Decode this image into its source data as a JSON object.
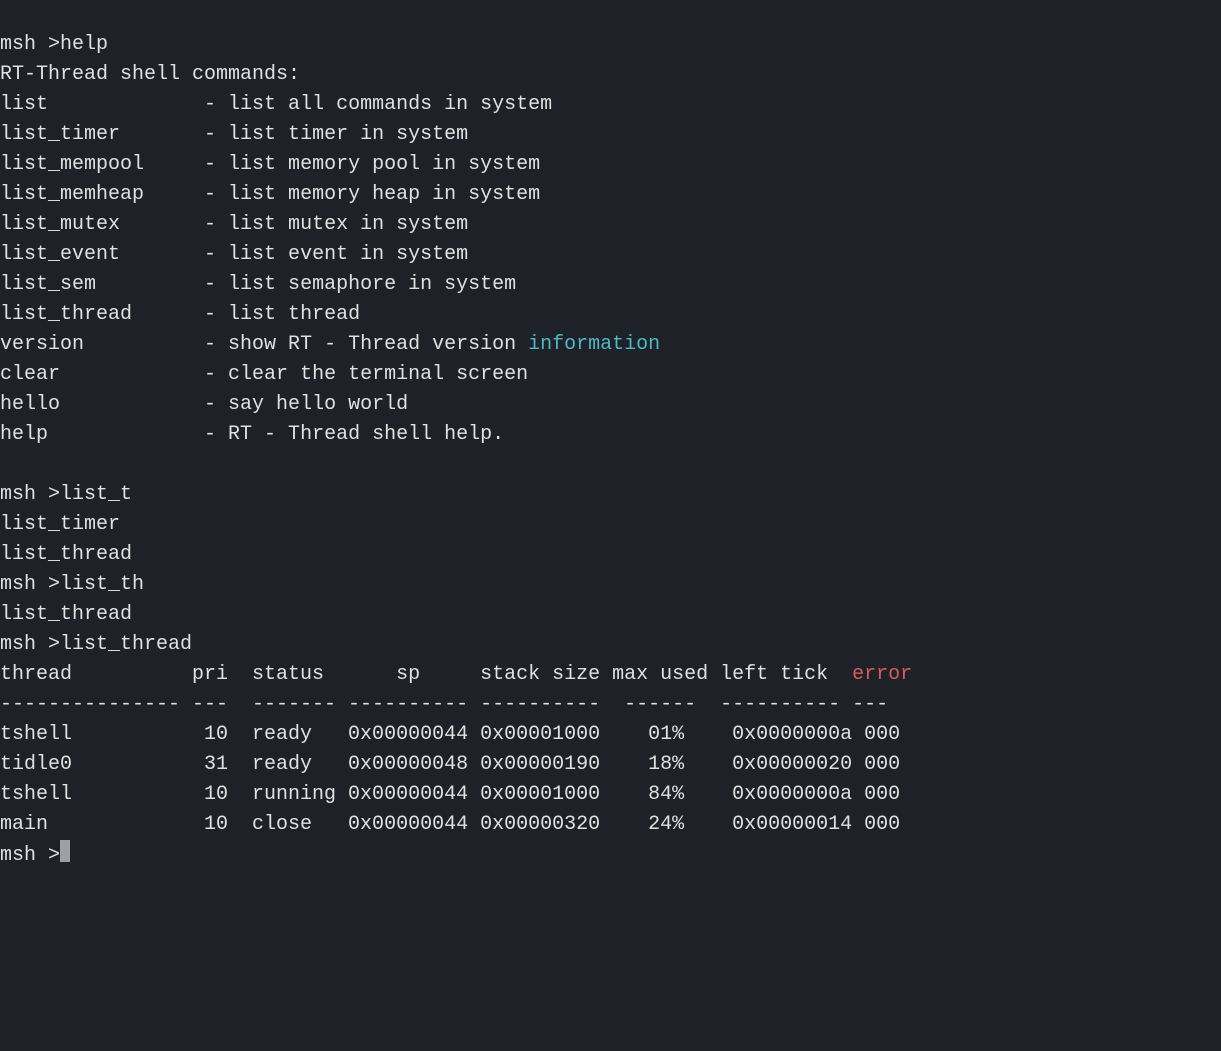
{
  "lines": {
    "0": {
      "prompt": "msh >",
      "cmd": "help"
    },
    "1": "RT-Thread shell commands:",
    "2": {
      "prompt": "msh >",
      "cmd": "list_t"
    },
    "3": "list_timer",
    "4": "list_thread",
    "5": {
      "prompt": "msh >",
      "cmd": "list_th"
    },
    "6": "list_thread",
    "7": {
      "prompt": "msh >",
      "cmd": "list_thread"
    },
    "8": {
      "prompt": "msh >"
    }
  },
  "help": [
    {
      "name": "list",
      "pad": "             ",
      "desc": "- list all commands in system"
    },
    {
      "name": "list_timer",
      "pad": "       ",
      "desc": "- list timer in system"
    },
    {
      "name": "list_mempool",
      "pad": "     ",
      "desc": "- list memory pool in system"
    },
    {
      "name": "list_memheap",
      "pad": "     ",
      "desc": "- list memory heap in system"
    },
    {
      "name": "list_mutex",
      "pad": "       ",
      "desc": "- list mutex in system"
    },
    {
      "name": "list_event",
      "pad": "       ",
      "desc": "- list event in system"
    },
    {
      "name": "list_sem",
      "pad": "         ",
      "desc": "- list semaphore in system"
    },
    {
      "name": "list_thread",
      "pad": "      ",
      "desc": "- list thread"
    },
    {
      "name": "version",
      "pad": "          ",
      "desc": "- show RT - Thread version ",
      "kw": "information"
    },
    {
      "name": "clear",
      "pad": "            ",
      "desc": "- clear the terminal screen"
    },
    {
      "name": "hello",
      "pad": "            ",
      "desc": "- say hello world"
    },
    {
      "name": "help",
      "pad": "             ",
      "desc": "- RT - Thread shell help."
    }
  ],
  "table": {
    "header": "thread          pri  status      sp     stack size max used left tick  ",
    "header_err": "error",
    "sep": "--------------- ---  ------- ---------- ----------  ------  ---------- ---",
    "rows": [
      "tshell           10  ready   0x00000044 0x00001000    01%    0x0000000a 000",
      "tidle0           31  ready   0x00000048 0x00000190    18%    0x00000020 000",
      "tshell           10  running 0x00000044 0x00001000    84%    0x0000000a 000",
      "main             10  close   0x00000044 0x00000320    24%    0x00000014 000"
    ]
  }
}
